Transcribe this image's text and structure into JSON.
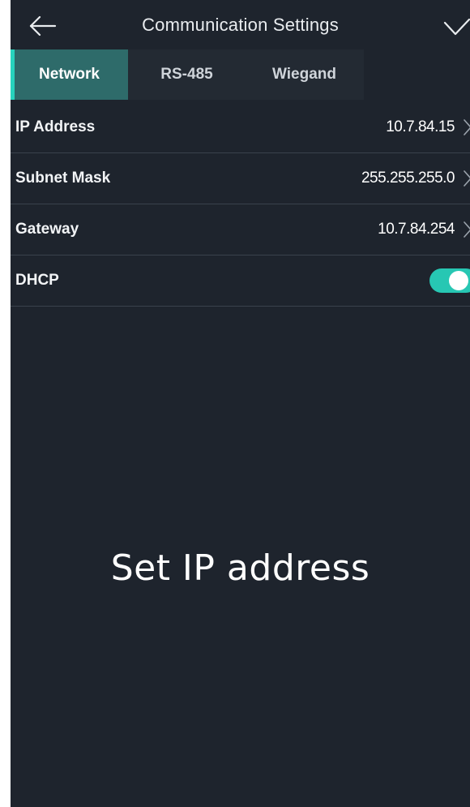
{
  "header": {
    "title": "Communication Settings",
    "back_icon": "arrow-left-icon",
    "confirm_icon": "checkmark-icon"
  },
  "tabs": [
    {
      "label": "Network",
      "active": true
    },
    {
      "label": "RS-485",
      "active": false
    },
    {
      "label": "Wiegand",
      "active": false
    }
  ],
  "settings": [
    {
      "label": "IP Address",
      "value": "10.7.84.15"
    },
    {
      "label": "Subnet Mask",
      "value": "255.255.255.0"
    },
    {
      "label": "Gateway",
      "value": "10.7.84.254"
    },
    {
      "label": "DHCP",
      "toggle": true
    }
  ],
  "caption": "Set IP address",
  "colors": {
    "background": "#1e242d",
    "accent": "#27d3bd",
    "active_tab": "#2e6b6a"
  }
}
